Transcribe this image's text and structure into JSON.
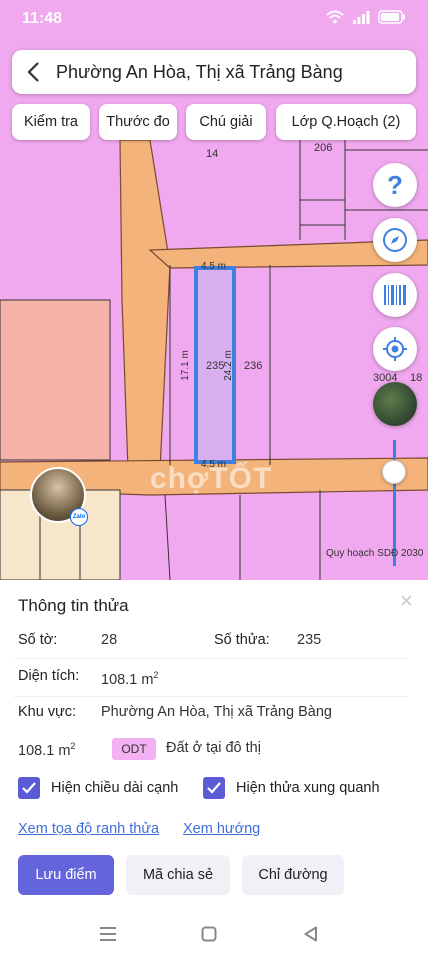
{
  "status_bar": {
    "time": "11:48"
  },
  "header": {
    "location": "Phường An Hòa, Thị xã Trảng Bàng"
  },
  "toolbar": {
    "check": "Kiểm tra",
    "measure": "Thước đo",
    "legend": "Chú giải",
    "layer": "Lớp Q.Hoạch (2)"
  },
  "map": {
    "parcel_labels": {
      "p14": "14",
      "p206": "206",
      "p235": "235",
      "p236": "236",
      "p3004": "3004",
      "p18": "18"
    },
    "dimensions": {
      "top": "4.5 m",
      "bottom": "4.5 m",
      "left": "17.1 m",
      "right": "24.2 m"
    },
    "watermark": "chợTỐT",
    "zoning_caption": "Quy hoạch SDĐ 2030",
    "colors": {
      "residential": "#f0a8ef",
      "road": "#f3b37a",
      "selected": "#3f7fe0",
      "land_other": "#f4b3a6"
    },
    "avatar_badge": "Zalo"
  },
  "controls": {
    "help_icon": "question-icon",
    "compass_icon": "compass-icon",
    "barcode_icon": "barcode-icon",
    "locate_icon": "crosshair-icon"
  },
  "parcel_info": {
    "title": "Thông tin thửa",
    "sheet_label": "Số tờ:",
    "sheet_value": "28",
    "parcel_label": "Số thửa:",
    "parcel_value": "235",
    "area_label": "Diện tích:",
    "area_value": "108.1 m",
    "area_unit_sup": "2",
    "region_label": "Khu vực:",
    "region_value": "Phường An Hòa, Thị xã Trảng Bàng",
    "land_area": "108.1 m",
    "land_area_sup": "2",
    "land_code": "ODT",
    "land_type": "Đất ở tại đô thị",
    "show_edge_lengths": "Hiện chiều dài cạnh",
    "show_surrounding": "Hiện thửa xung quanh",
    "link_coords": "Xem tọa độ ranh thửa",
    "link_direction": "Xem hướng",
    "save_point": "Lưu điểm",
    "share_code": "Mã chia sẻ",
    "directions": "Chỉ đường"
  }
}
